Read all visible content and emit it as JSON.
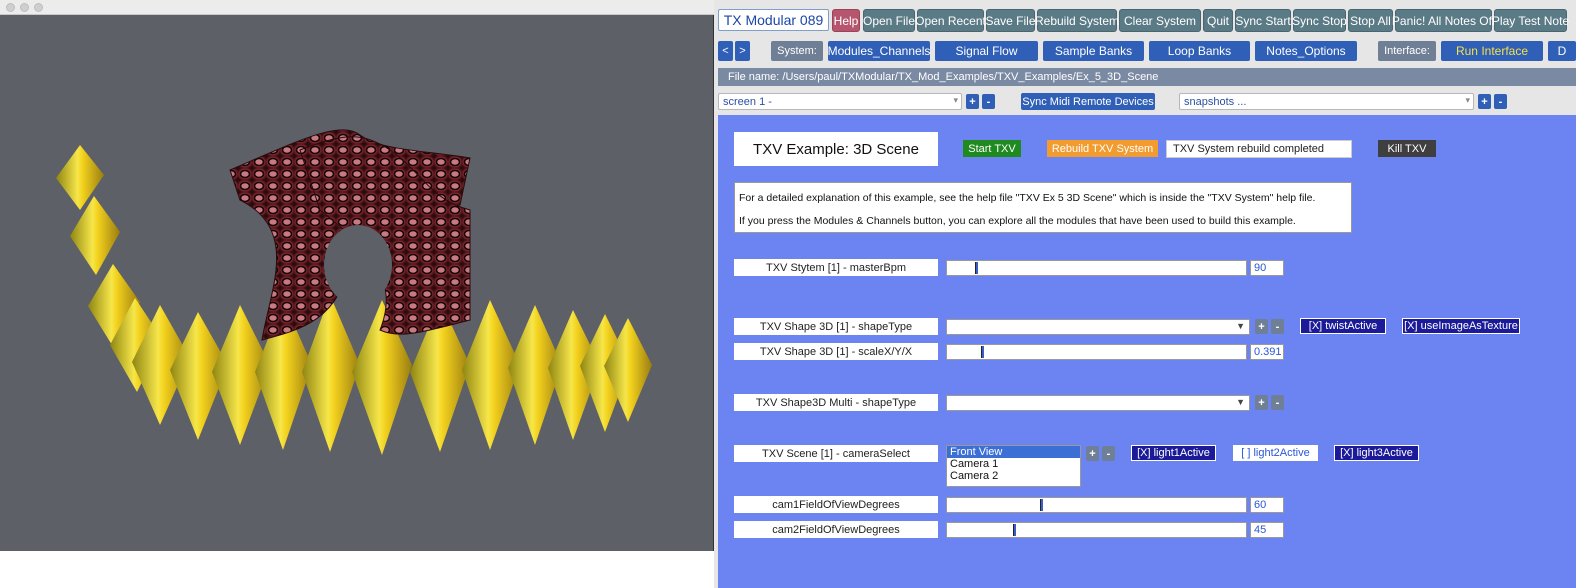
{
  "app": {
    "title": "TX Modular 089",
    "toolbar": [
      "Help",
      "Open File",
      "Open Recent",
      "Save File",
      "Rebuild System",
      "Clear System",
      "Quit",
      "Sync Start",
      "Sync Stop",
      "Stop All",
      "Panic! All Notes Off",
      "Play Test Note"
    ]
  },
  "nav": {
    "prev": "<",
    "next": ">",
    "system_label": "System:",
    "system_tabs": [
      "Modules_Channels",
      "Signal Flow",
      "Sample Banks",
      "Loop Banks",
      "Notes_Options"
    ],
    "interface_label": "Interface:",
    "run_interface": "Run Interface",
    "overflow": "D"
  },
  "file_name": "File name: /Users/paul/TXModular/TX_Mod_Examples/TXV_Examples/Ex_5_3D_Scene",
  "screen_select": {
    "value": "screen 1 -",
    "plus": "+",
    "minus": "-"
  },
  "sync_midi": "Sync Midi Remote Devices",
  "snapshots_select": {
    "value": "snapshots ...",
    "plus": "+",
    "minus": "-"
  },
  "panel": {
    "title": "TXV Example:  3D Scene",
    "start": "Start TXV",
    "rebuild": "Rebuild TXV System",
    "status": "TXV System rebuild completed",
    "kill": "Kill TXV",
    "info_line1": "For a detailed explanation of this example, see the help file \"TXV Ex 5 3D Scene\" which is inside the \"TXV System\" help file.",
    "info_line2": "If you press the Modules & Channels button, you can explore all the modules that have been used to build this example.",
    "master_bpm": {
      "label": "TXV Stytem [1] - masterBpm",
      "value": "90"
    },
    "shape_type": {
      "label": "TXV Shape 3D [1] - shapeType",
      "plus": "+",
      "minus": "-",
      "twist": "[X] twistActive",
      "texture": "[X] useImageAsTexture"
    },
    "scale": {
      "label": "TXV Shape 3D [1] - scaleX/Y/X",
      "value": "0.391"
    },
    "multi_shape_type": {
      "label": "TXV Shape3D Multi - shapeType",
      "plus": "+",
      "minus": "-"
    },
    "camera_select": {
      "label": "TXV Scene [1] - cameraSelect",
      "options": [
        "Front View",
        "Camera 1",
        "Camera 2"
      ],
      "plus": "+",
      "minus": "-",
      "light1": "[X] light1Active",
      "light2": "[  ] light2Active",
      "light3": "[X] light3Active"
    },
    "cam1_fov": {
      "label": "cam1FieldOfViewDegrees",
      "value": "60"
    },
    "cam2_fov": {
      "label": "cam2FieldOfViewDegrees",
      "value": "45"
    }
  },
  "colors": {
    "panel_bg": "#6b84f2",
    "render_bg": "#5d6066",
    "toolbar_btn": "#5a7a86",
    "help_btn": "#b6566e",
    "nav_btn": "#2f5fb6"
  }
}
